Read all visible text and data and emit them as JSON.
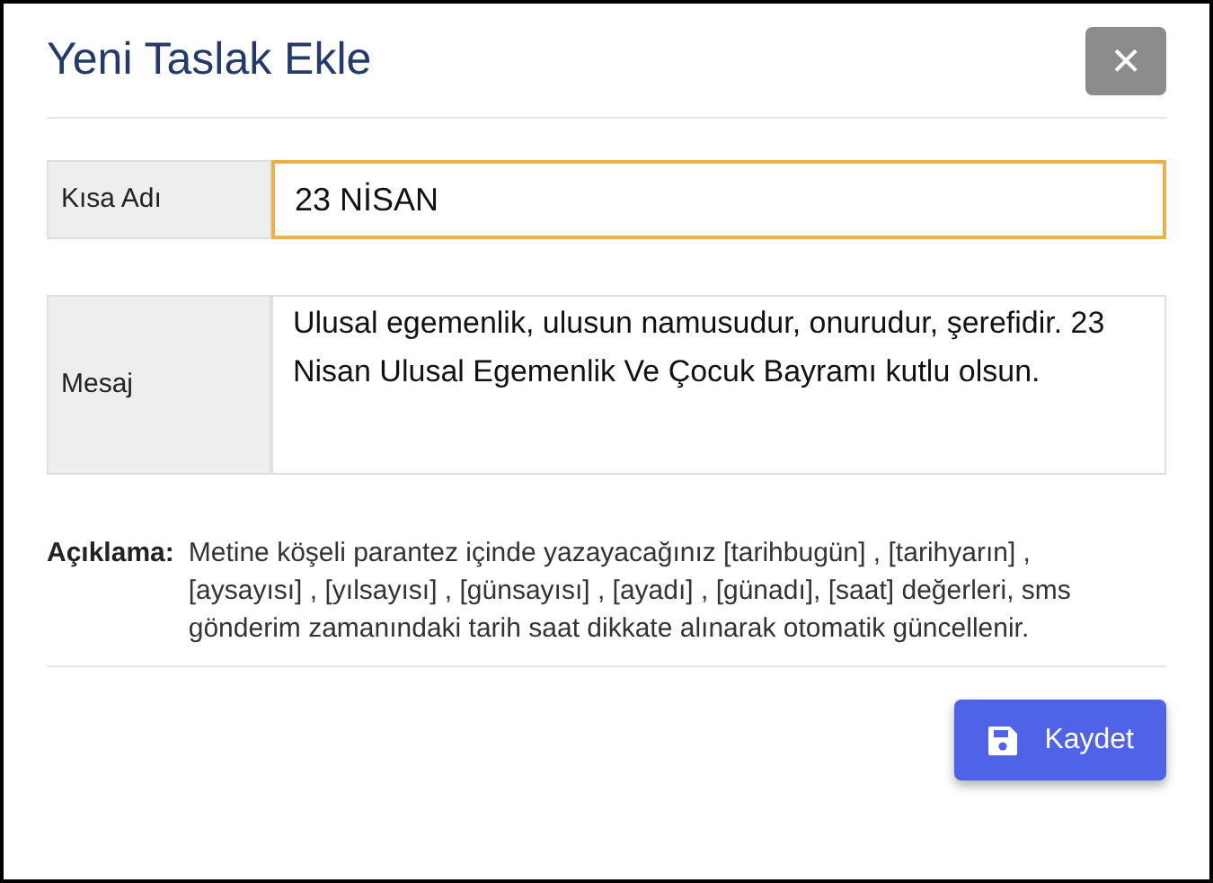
{
  "dialog": {
    "title": "Yeni Taslak Ekle",
    "close_label": "×"
  },
  "fields": [
    {
      "kind": "input",
      "label": "Kısa Adı",
      "value": "23 NİSAN",
      "focused": true
    },
    {
      "kind": "textarea",
      "label": "Mesaj",
      "value": "Ulusal egemenlik, ulusun namusudur, onurudur, şerefidir. 23 Nisan Ulusal Egemenlik Ve Çocuk Bayramı kutlu olsun.",
      "focused": false
    }
  ],
  "note": {
    "label": "Açıklama:",
    "text": "Metine köşeli parantez içinde yazayacağınız [tarihbugün] , [tarihyarın] , [aysayısı] , [yılsayısı] , [günsayısı] , [ayadı] , [günadı], [saat] değerleri, sms gönderim zamanındaki tarih saat dikkate alınarak otomatik güncellenir."
  },
  "buttons": [
    {
      "kind": "save",
      "label": "Kaydet"
    }
  ]
}
